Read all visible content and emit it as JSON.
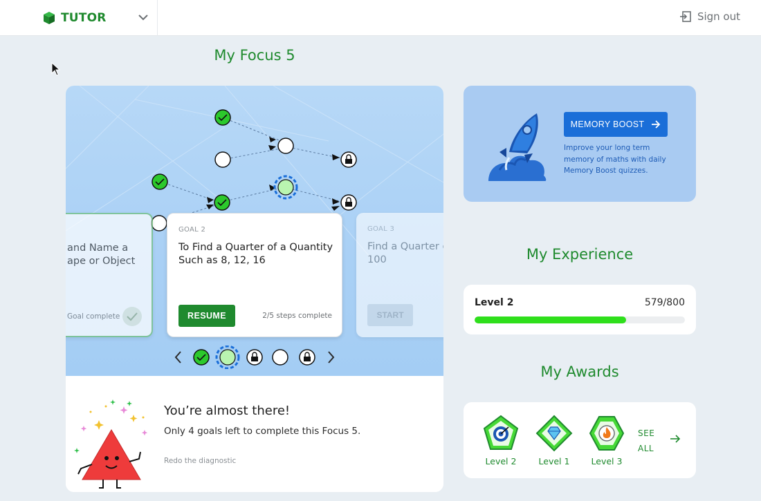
{
  "header": {
    "brand": "TUTOR",
    "signout_label": "Sign out"
  },
  "page": {
    "title": "My Focus 5"
  },
  "goals": [
    {
      "label": "",
      "title_lines": [
        "and Name a",
        "ape or Object"
      ],
      "status": "Goal complete"
    },
    {
      "label": "GOAL 2",
      "title_lines": [
        "To Find a Quarter of a Quantity",
        "Such as 8, 12, 16"
      ],
      "button": "RESUME",
      "steps": "2/5 steps complete"
    },
    {
      "label": "GOAL 3",
      "title_lines": [
        "Find a Quarter o",
        "100"
      ],
      "button": "START"
    }
  ],
  "encourage": {
    "title": "You’re almost there!",
    "text": "Only 4 goals left to complete this Focus 5.",
    "redo_link": "Redo the diagnostic"
  },
  "boost": {
    "button": "MEMORY BOOST",
    "description": "Improve your long term memory of maths with daily Memory Boost quizzes."
  },
  "experience": {
    "title": "My Experience",
    "level": "Level 2",
    "points": "579/800",
    "progress": 0.72
  },
  "awards": {
    "title": "My Awards",
    "items": [
      {
        "label": "Level 2",
        "icon": "target-icon"
      },
      {
        "label": "Level 1",
        "icon": "diamond-icon"
      },
      {
        "label": "Level 3",
        "icon": "fire-icon"
      }
    ],
    "see_all_line1": "SEE",
    "see_all_line2": "ALL"
  },
  "colors": {
    "brand_green": "#1f8a2e",
    "progress_green": "#2fdf1c",
    "boost_blue": "#1a6ed8",
    "map_blue": "#b7d8f7"
  }
}
